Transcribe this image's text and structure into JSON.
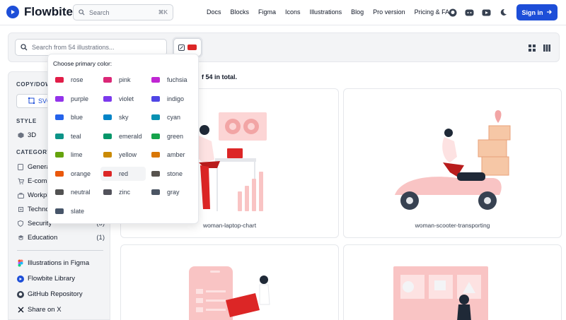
{
  "header": {
    "logo_text": "Flowbite",
    "search_placeholder": "Search",
    "search_kbd": "⌘K",
    "nav": [
      "Docs",
      "Blocks",
      "Figma",
      "Icons",
      "Illustrations",
      "Blog",
      "Pro version",
      "Pricing & FAQ"
    ],
    "icons": [
      "github-icon",
      "discord-icon",
      "youtube-icon",
      "moon-icon"
    ],
    "signin_label": "Sign in",
    "accent": "#1d4ed8"
  },
  "toolbar": {
    "search_placeholder": "Search from 54 illustrations...",
    "selected_color": "#dc2626"
  },
  "dropdown": {
    "title": "Choose primary color:",
    "selected": "red",
    "options": [
      {
        "label": "rose",
        "color": "#e11d48"
      },
      {
        "label": "pink",
        "color": "#db2777"
      },
      {
        "label": "fuchsia",
        "color": "#c026d3"
      },
      {
        "label": "purple",
        "color": "#9333ea"
      },
      {
        "label": "violet",
        "color": "#7c3aed"
      },
      {
        "label": "indigo",
        "color": "#4f46e5"
      },
      {
        "label": "blue",
        "color": "#2563eb"
      },
      {
        "label": "sky",
        "color": "#0284c7"
      },
      {
        "label": "cyan",
        "color": "#0891b2"
      },
      {
        "label": "teal",
        "color": "#0d9488"
      },
      {
        "label": "emerald",
        "color": "#059669"
      },
      {
        "label": "green",
        "color": "#16a34a"
      },
      {
        "label": "lime",
        "color": "#65a30d"
      },
      {
        "label": "yellow",
        "color": "#ca8a04"
      },
      {
        "label": "amber",
        "color": "#d97706"
      },
      {
        "label": "orange",
        "color": "#ea580c"
      },
      {
        "label": "red",
        "color": "#dc2626"
      },
      {
        "label": "stone",
        "color": "#57534e"
      },
      {
        "label": "neutral",
        "color": "#525252"
      },
      {
        "label": "zinc",
        "color": "#52525b"
      },
      {
        "label": "gray",
        "color": "#4b5563"
      },
      {
        "label": "slate",
        "color": "#475569"
      }
    ]
  },
  "sidebar": {
    "copy_title": "COPY/DOWN",
    "svg_label": "SVG",
    "style_title": "STYLE",
    "style_item": "3D",
    "category_title": "CATEGORY",
    "categories": [
      {
        "label": "Genera",
        "count": ""
      },
      {
        "label": "E-comm",
        "count": ""
      },
      {
        "label": "Workpla",
        "count": ""
      },
      {
        "label": "Techno",
        "count": ""
      },
      {
        "label": "Security",
        "count": "(5)"
      },
      {
        "label": "Education",
        "count": "(1)"
      }
    ],
    "links": [
      {
        "label": "Illustrations in Figma",
        "icon": "figma-icon"
      },
      {
        "label": "Flowbite Library",
        "icon": "flowbite-icon"
      },
      {
        "label": "GitHub Repository",
        "icon": "github-icon"
      },
      {
        "label": "Share on X",
        "icon": "x-icon"
      }
    ]
  },
  "main": {
    "results_text": "f 54 in total.",
    "cards": [
      {
        "label": "woman-laptop-chart"
      },
      {
        "label": "woman-scooter-transporting"
      },
      {
        "label": ""
      },
      {
        "label": ""
      }
    ]
  }
}
